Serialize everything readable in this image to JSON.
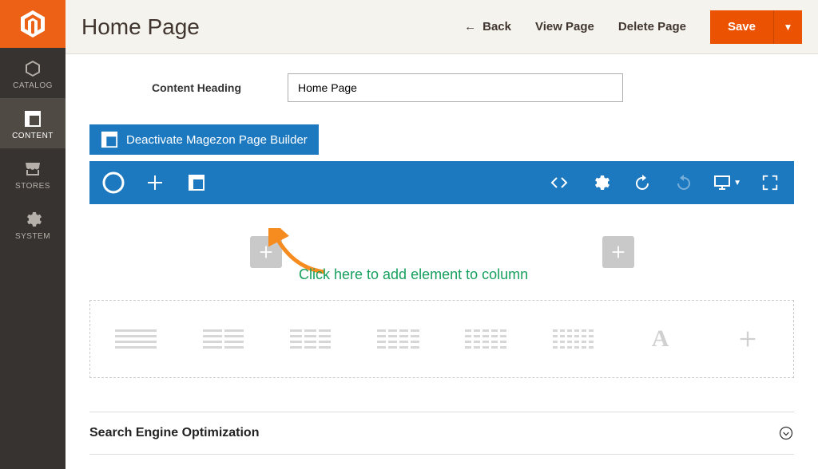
{
  "sidebar": {
    "items": [
      {
        "label": "CATALOG"
      },
      {
        "label": "CONTENT"
      },
      {
        "label": "STORES"
      },
      {
        "label": "SYSTEM"
      }
    ]
  },
  "header": {
    "title": "Home Page",
    "back": "Back",
    "view": "View Page",
    "delete": "Delete Page",
    "save": "Save"
  },
  "fields": {
    "content_heading_label": "Content Heading",
    "content_heading_value": "Home Page"
  },
  "builder": {
    "deactivate_label": "Deactivate Magezon Page Builder"
  },
  "annotation": {
    "text": "Click here to add element to column"
  },
  "element_options": {
    "text_label": "A"
  },
  "seo": {
    "title": "Search Engine Optimization"
  }
}
